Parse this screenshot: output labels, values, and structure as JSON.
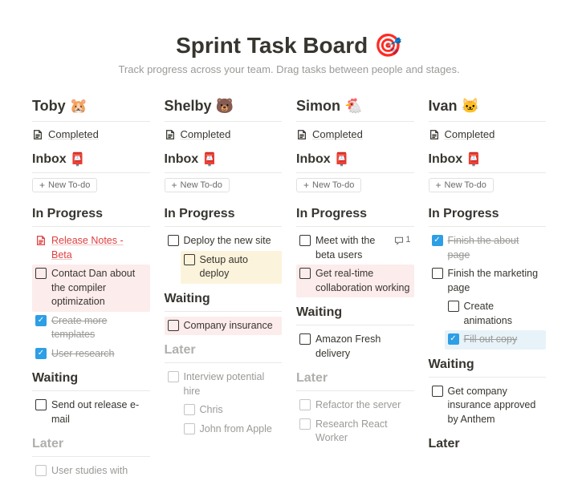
{
  "header": {
    "title": "Sprint Task Board 🎯",
    "subtitle": "Track progress across your team.  Drag tasks between people and stages."
  },
  "common": {
    "completed_label": "Completed",
    "inbox_label": "Inbox",
    "inbox_emoji": "📮",
    "new_todo_label": "New To-do",
    "in_progress_label": "In Progress",
    "waiting_label": "Waiting",
    "later_label": "Later"
  },
  "columns": [
    {
      "name": "Toby 🐹",
      "in_progress": [
        {
          "kind": "doc",
          "text": "Release Notes - Beta"
        },
        {
          "kind": "todo",
          "text": "Contact Dan about the compiler optimization",
          "hl": "pink"
        },
        {
          "kind": "done",
          "text": "Create more templates"
        },
        {
          "kind": "done",
          "text": "User research"
        }
      ],
      "waiting": [
        {
          "kind": "todo",
          "text": "Send out release e-mail"
        }
      ],
      "later_faded": true,
      "later": [
        {
          "kind": "todo_faded",
          "text": "User studies with"
        }
      ]
    },
    {
      "name": "Shelby 🐻",
      "in_progress": [
        {
          "kind": "todo",
          "text": "Deploy the new site"
        },
        {
          "kind": "todo",
          "text": "Setup auto deploy",
          "hl": "yellow",
          "indent": 1
        }
      ],
      "waiting": [
        {
          "kind": "todo",
          "text": "Company insurance",
          "hl": "orange"
        }
      ],
      "later_faded": true,
      "later": [
        {
          "kind": "todo_faded",
          "text": "Interview potential hire"
        },
        {
          "kind": "todo_faded",
          "text": "Chris",
          "indent": 1
        },
        {
          "kind": "todo_faded",
          "text": "John from Apple",
          "indent": 1
        }
      ]
    },
    {
      "name": "Simon 🐔",
      "in_progress": [
        {
          "kind": "todo",
          "text": "Meet with the beta users",
          "comments": 1
        },
        {
          "kind": "todo",
          "text": "Get real-time collaboration working",
          "hl": "pink"
        }
      ],
      "waiting": [
        {
          "kind": "todo",
          "text": "Amazon Fresh delivery"
        }
      ],
      "later_faded": true,
      "later": [
        {
          "kind": "todo_faded",
          "text": "Refactor the server"
        },
        {
          "kind": "todo_faded",
          "text": "Research React Worker"
        }
      ]
    },
    {
      "name": "Ivan 🐱",
      "in_progress": [
        {
          "kind": "done",
          "text": "Finish the about page"
        },
        {
          "kind": "todo",
          "text": "Finish the marketing page"
        },
        {
          "kind": "todo",
          "text": "Create animations",
          "indent": 1
        },
        {
          "kind": "done",
          "text": "Fill out copy",
          "indent": 1,
          "hl": "blue"
        }
      ],
      "waiting": [
        {
          "kind": "todo",
          "text": "Get company insurance approved by Anthem"
        }
      ],
      "later_faded": false,
      "later": []
    }
  ]
}
